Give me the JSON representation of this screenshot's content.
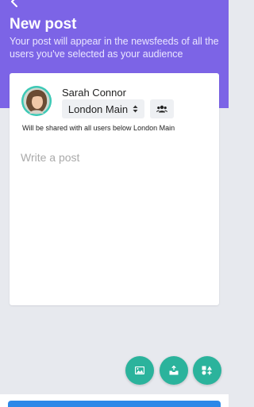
{
  "header": {
    "title": "New post",
    "subtitle": "Your post will appear in the newsfeeds of all the users you've selected as your audience"
  },
  "composer": {
    "author": "Sarah Connor",
    "location": "London Main",
    "share_note": "Will be shared with all users below London Main",
    "placeholder": "Write a post"
  },
  "icons": {
    "back": "chevron-left-icon",
    "location_sort": "sort-updown-icon",
    "audience": "users-icon",
    "photo": "image-icon",
    "attach": "inbox-upload-icon",
    "shapes": "shapes-icon"
  },
  "colors": {
    "header": "#7c64e6",
    "fab": "#2bb39c",
    "primary": "#2c88e8",
    "avatar_ring": "#3ec9b6"
  }
}
